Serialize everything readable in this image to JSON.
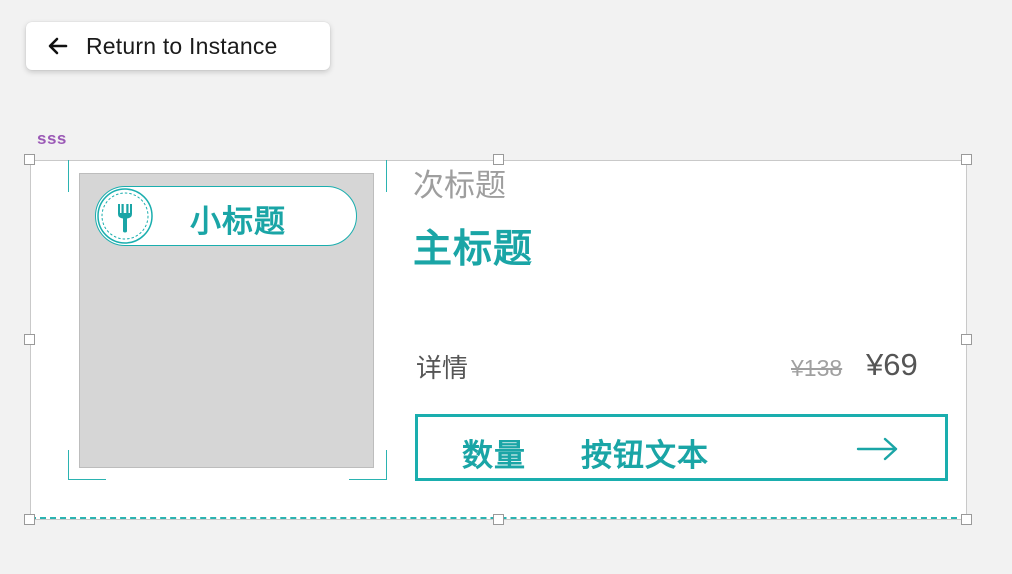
{
  "return_button": {
    "label": "Return to Instance",
    "icon": "arrow-left-icon"
  },
  "component": {
    "name": "sss"
  },
  "card": {
    "tag": {
      "icon": "fork-icon",
      "label": "小标题"
    },
    "subtitle": "次标题",
    "title": "主标题",
    "details_label": "详情",
    "original_price": "¥138",
    "price": "¥69",
    "button": {
      "quantity_label": "数量",
      "text": "按钮文本",
      "icon": "arrow-right-icon"
    }
  },
  "colors": {
    "accent": "#1aa5a6",
    "frame_label": "#9b59b6",
    "image_placeholder": "#d6d6d6"
  }
}
